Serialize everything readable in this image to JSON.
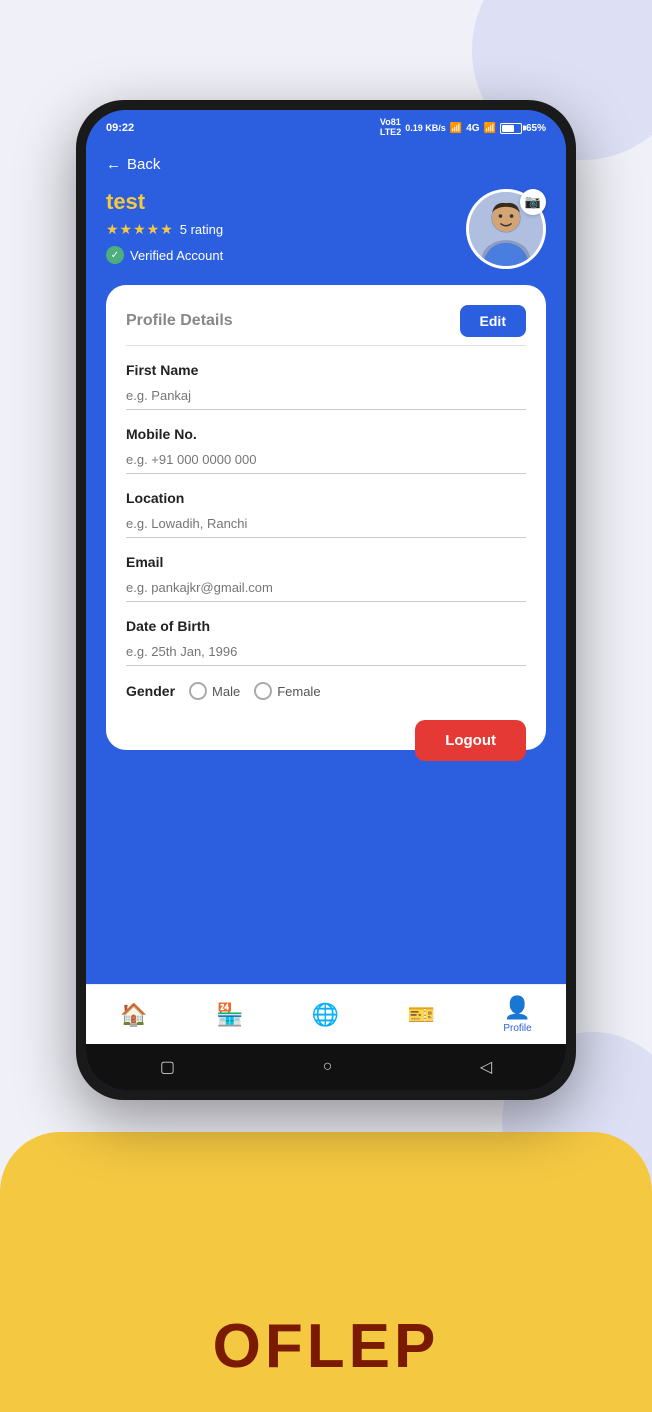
{
  "app": {
    "title": "OFLEP"
  },
  "status_bar": {
    "time": "09:22",
    "network1": "Vo81",
    "network2": "LTE2",
    "data_speed": "0.19 KB/s",
    "signal1": "4G",
    "battery_pct": "65%"
  },
  "back_button": {
    "label": "Back"
  },
  "profile": {
    "username": "test",
    "rating_value": "5 rating",
    "verified_label": "Verified Account",
    "camera_icon": "📷"
  },
  "profile_card": {
    "title": "Profile Details",
    "edit_button": "Edit",
    "fields": [
      {
        "label": "First Name",
        "placeholder": "e.g. Pankaj",
        "value": ""
      },
      {
        "label": "Mobile No.",
        "placeholder": "e.g. +91 000 0000 000",
        "value": ""
      },
      {
        "label": "Location",
        "placeholder": "e.g. Lowadih, Ranchi",
        "value": ""
      },
      {
        "label": "Email",
        "placeholder": "e.g. pankajkr@gmail.com",
        "value": ""
      },
      {
        "label": "Date of Birth",
        "placeholder": "e.g. 25th Jan, 1996",
        "value": ""
      }
    ],
    "gender": {
      "label": "Gender",
      "options": [
        "Male",
        "Female"
      ]
    },
    "logout_button": "Logout"
  },
  "bottom_nav": {
    "items": [
      {
        "label": "",
        "icon": "🏠",
        "active": false
      },
      {
        "label": "",
        "icon": "🏪",
        "active": false
      },
      {
        "label": "",
        "icon": "🌐",
        "active": false
      },
      {
        "label": "",
        "icon": "🎫",
        "active": false
      },
      {
        "label": "Profile",
        "icon": "👤",
        "active": true
      }
    ]
  },
  "android_nav": {
    "buttons": [
      "▢",
      "○",
      "◁"
    ]
  }
}
